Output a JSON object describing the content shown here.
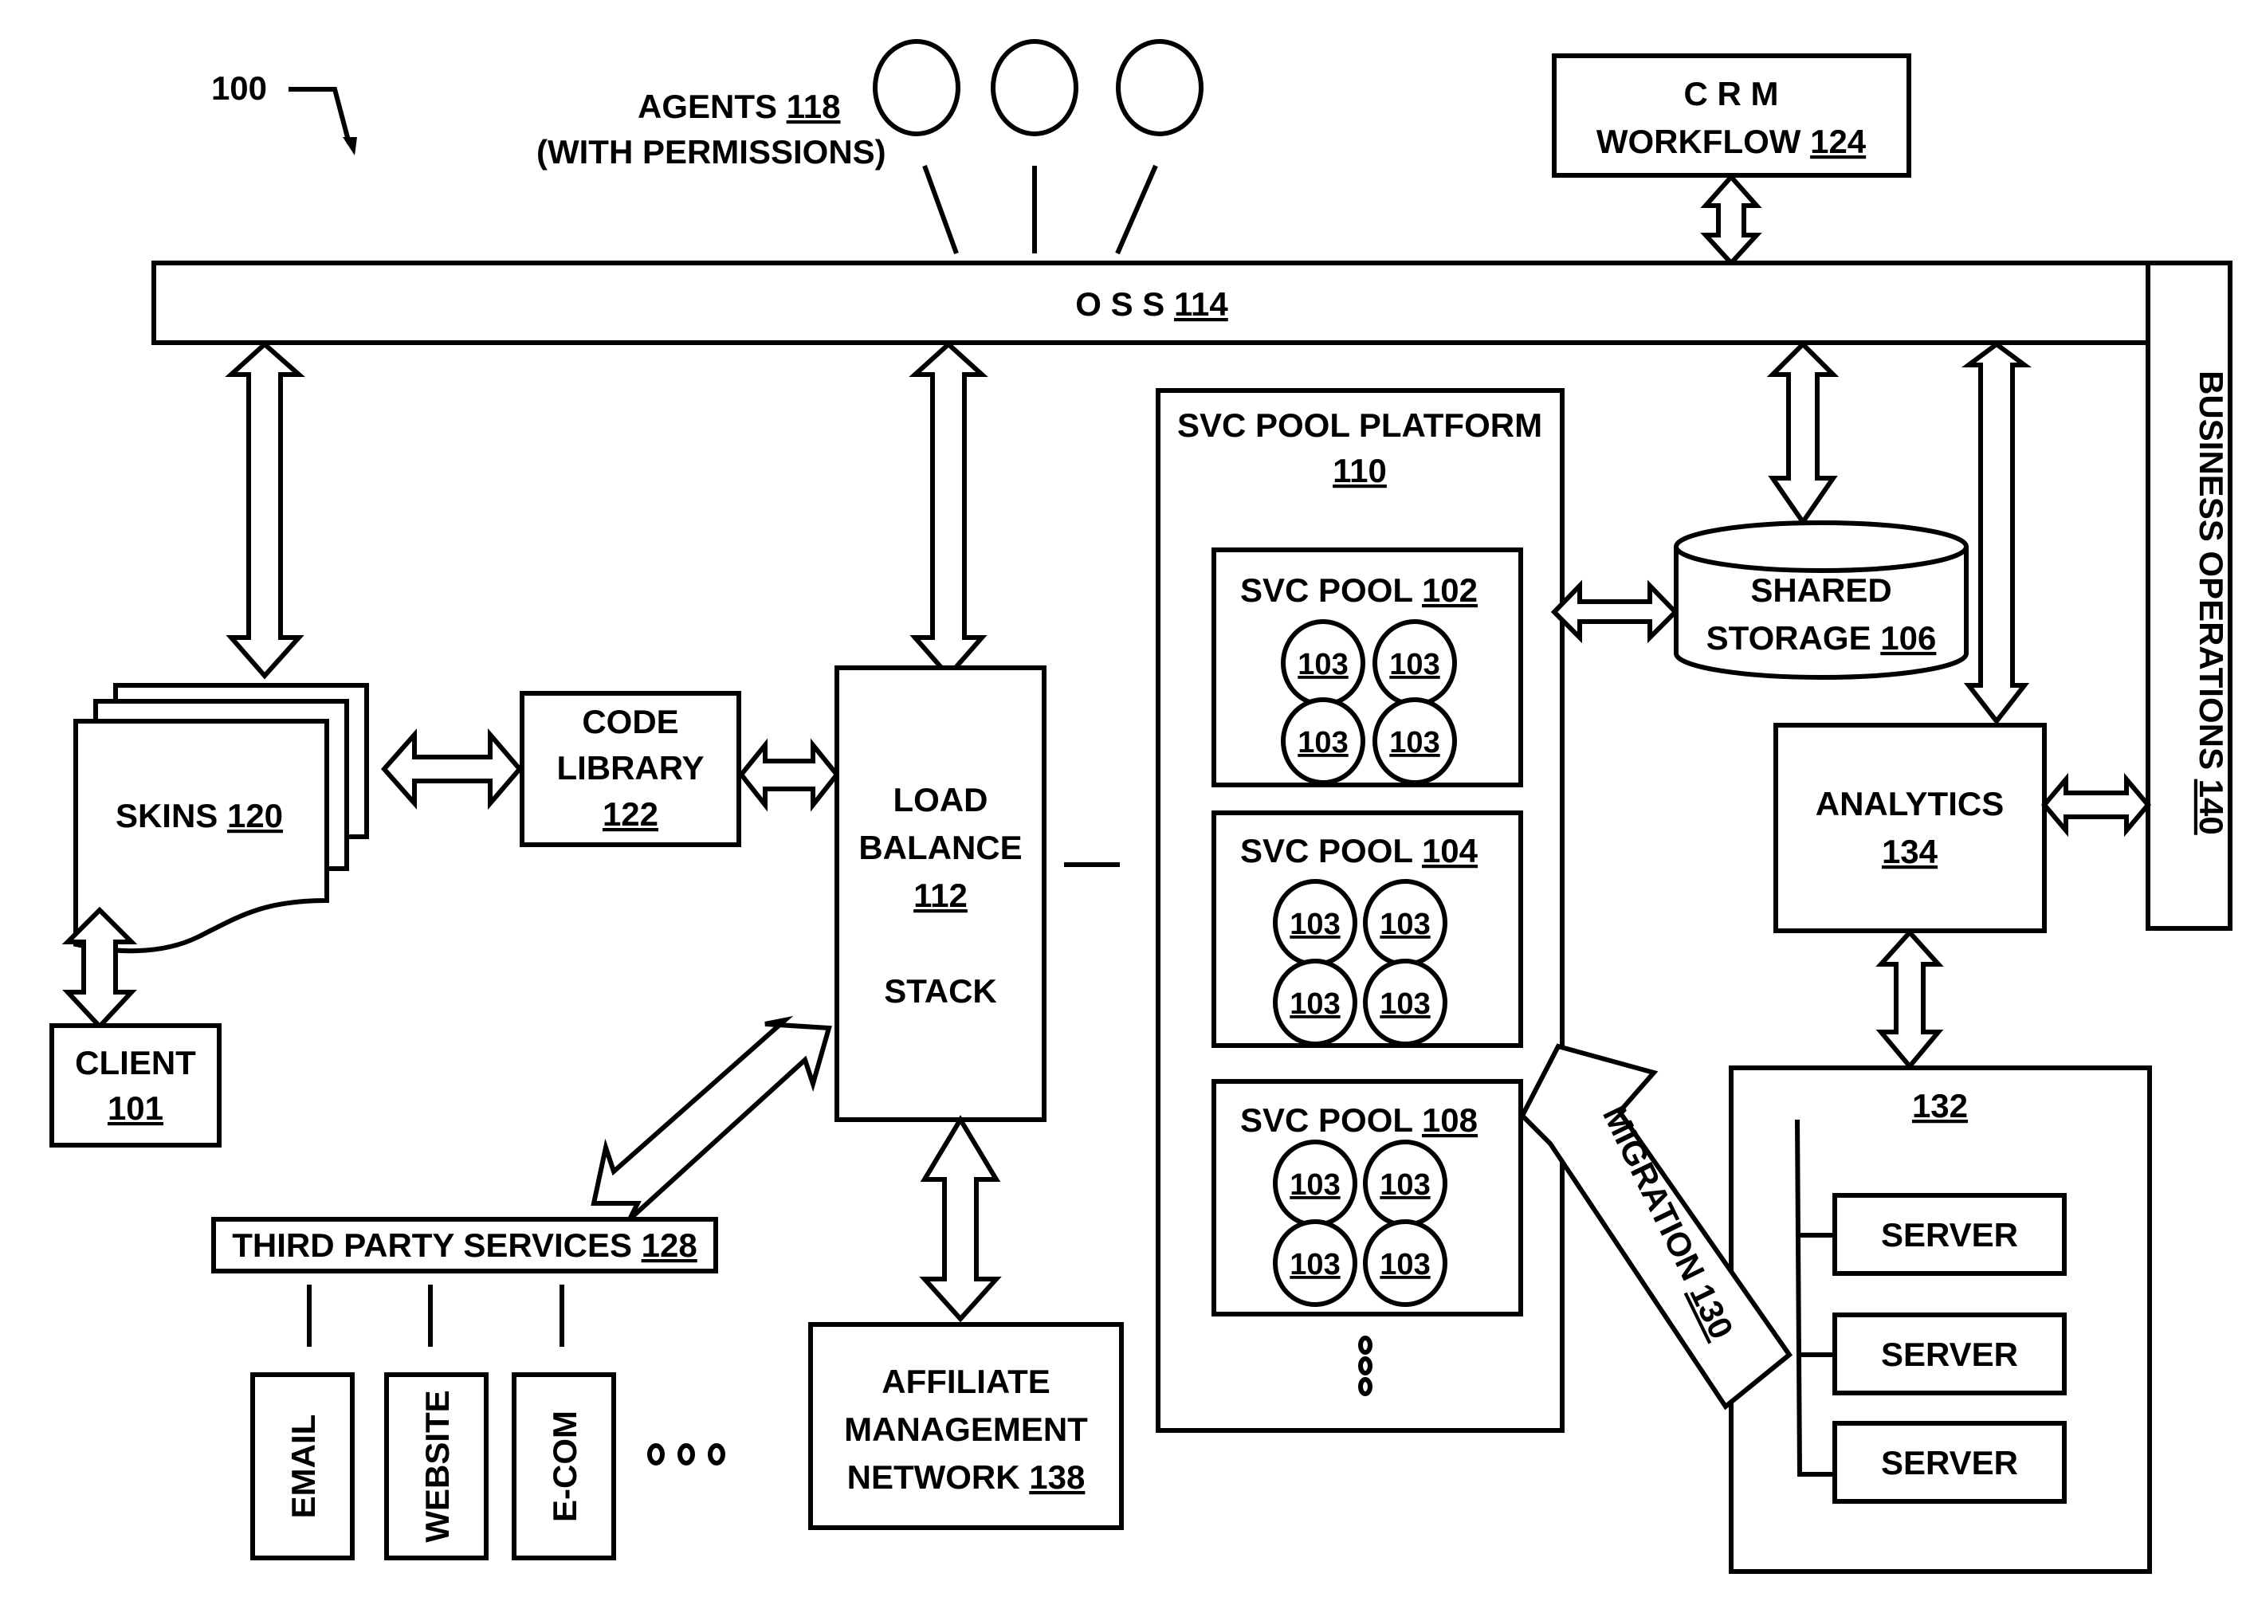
{
  "figure": {
    "ref": "100",
    "agents": {
      "label": "AGENTS",
      "num": "118",
      "sub": "(WITH PERMISSIONS)"
    },
    "crm": {
      "line1": "C R M",
      "line2": "WORKFLOW",
      "num": "124"
    },
    "oss": {
      "label": "O S S",
      "num": "114"
    },
    "business_ops": {
      "label": "BUSINESS OPERATIONS",
      "num": "140"
    },
    "svc_platform": {
      "label": "SVC POOL PLATFORM",
      "num": "110"
    },
    "pools": [
      {
        "label": "SVC POOL",
        "num": "102"
      },
      {
        "label": "SVC POOL",
        "num": "104"
      },
      {
        "label": "SVC POOL",
        "num": "108"
      }
    ],
    "pool_node": "103",
    "shared_storage": {
      "line1": "SHARED",
      "line2": "STORAGE",
      "num": "106"
    },
    "analytics": {
      "label": "ANALYTICS",
      "num": "134"
    },
    "server_group": {
      "num": "132",
      "servers": [
        "SERVER",
        "SERVER",
        "SERVER"
      ]
    },
    "migration": {
      "label": "MIGRATION",
      "num": "130"
    },
    "skins": {
      "label": "SKINS",
      "num": "120"
    },
    "code_library": {
      "line1": "CODE",
      "line2": "LIBRARY",
      "num": "122"
    },
    "load_balance": {
      "line1": "LOAD",
      "line2": "BALANCE",
      "num": "112",
      "line3": "STACK"
    },
    "client": {
      "label": "CLIENT",
      "num": "101"
    },
    "third_party": {
      "label": "THIRD PARTY SERVICES",
      "num": "128",
      "services": [
        "EMAIL",
        "WEBSITE",
        "E-COM"
      ]
    },
    "affiliate": {
      "line1": "AFFILIATE",
      "line2": "MANAGEMENT",
      "line3": "NETWORK",
      "num": "138"
    }
  }
}
